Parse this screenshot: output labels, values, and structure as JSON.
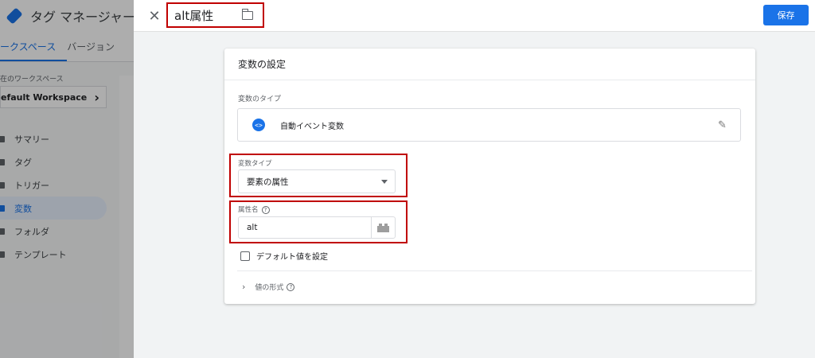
{
  "background_app": {
    "title": "タグ マネージャー",
    "tabs": [
      {
        "label": "ークスペース",
        "active": true
      },
      {
        "label": "バージョン",
        "active": false
      }
    ],
    "workspace_label": "在のワークスペース",
    "workspace_name": "efault Workspace",
    "workspace_chevron": "›",
    "nav": [
      {
        "label": "サマリー",
        "active": false
      },
      {
        "label": "タグ",
        "active": false
      },
      {
        "label": "トリガー",
        "active": false
      },
      {
        "label": "変数",
        "active": true
      },
      {
        "label": "フォルダ",
        "active": false
      },
      {
        "label": "テンプレート",
        "active": false
      }
    ]
  },
  "editor": {
    "close_glyph": "✕",
    "variable_name": "alt属性",
    "save_label": "保存",
    "card_title": "変数の設定",
    "variable_type_section_label": "変数のタイプ",
    "variable_type_icon_glyph": "<>",
    "variable_type_name": "自動イベント変数",
    "pencil_glyph": "✎",
    "var_type_field_label": "変数タイプ",
    "var_type_selected": "要素の属性",
    "attribute_name_label": "属性名",
    "help_glyph": "?",
    "attribute_name_value": "alt",
    "default_value_checkbox_label": "デフォルト値を設定",
    "default_value_checked": false,
    "chevron_glyph": "›",
    "value_format_label": "値の形式"
  },
  "colors": {
    "accent": "#1a73e8",
    "highlight": "#c00000"
  }
}
